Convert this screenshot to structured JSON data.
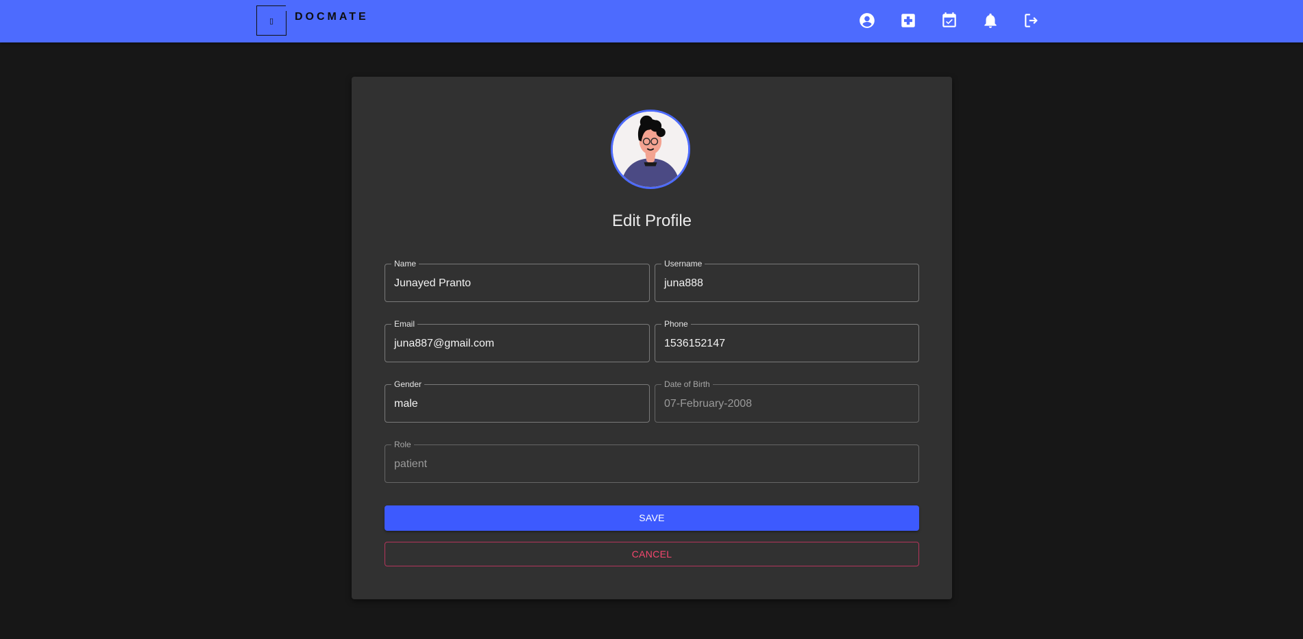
{
  "header": {
    "brand": "DOCMATE",
    "logo_glyph": "▯",
    "bar_color": "#4d6bfe",
    "icons": [
      {
        "name": "account-circle-icon"
      },
      {
        "name": "medical-add-icon"
      },
      {
        "name": "calendar-check-icon"
      },
      {
        "name": "bell-icon"
      },
      {
        "name": "logout-icon"
      }
    ]
  },
  "profile": {
    "title": "Edit Profile",
    "fields": {
      "name": {
        "label": "Name",
        "value": "Junayed Pranto"
      },
      "username": {
        "label": "Username",
        "value": "juna888"
      },
      "email": {
        "label": "Email",
        "value": "juna887@gmail.com"
      },
      "phone": {
        "label": "Phone",
        "value": "1536152147"
      },
      "gender": {
        "label": "Gender",
        "value": "male"
      },
      "dob": {
        "label": "Date of Birth",
        "value": "07-February-2008"
      },
      "role": {
        "label": "Role",
        "value": "patient"
      }
    },
    "save_label": "SAVE",
    "cancel_label": "CANCEL"
  },
  "colors": {
    "primary": "#3d5afe",
    "cancel": "#f5476e",
    "background": "#171717",
    "card": "#313131"
  }
}
